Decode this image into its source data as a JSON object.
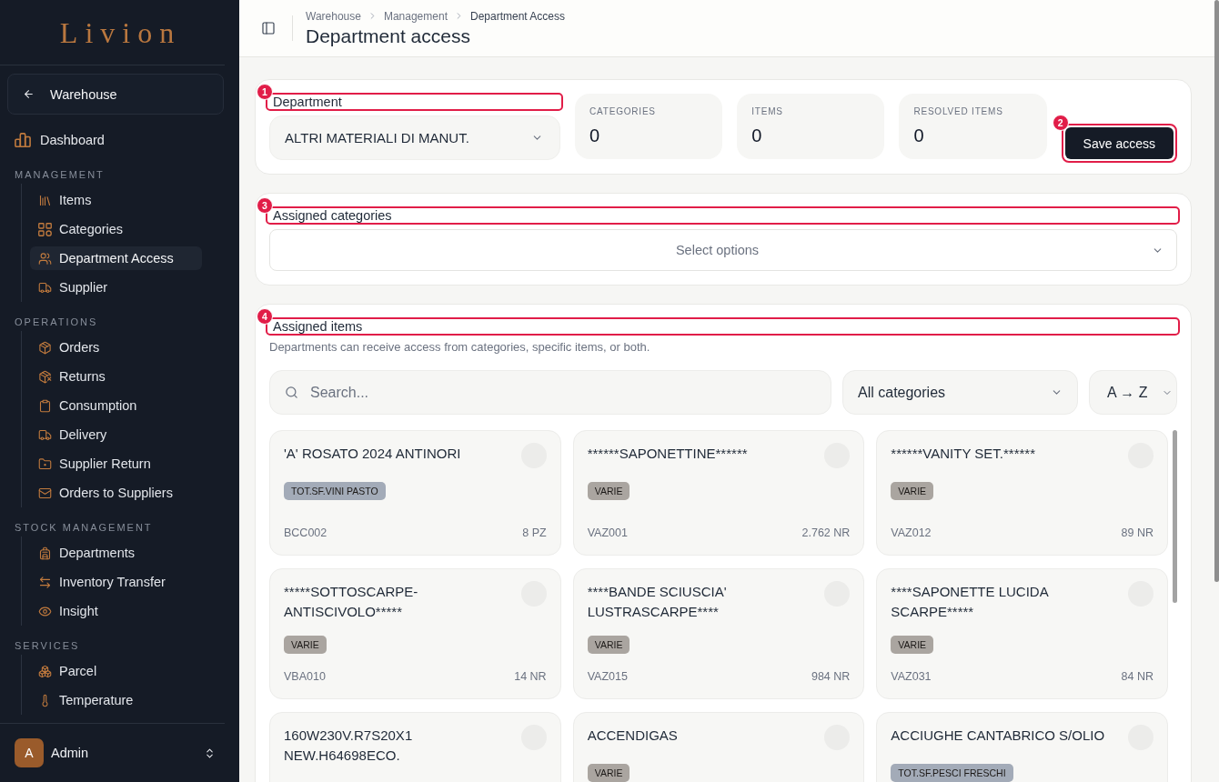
{
  "sidebar": {
    "logo": "Livion",
    "back_button": {
      "label": "Warehouse"
    },
    "top_items": [
      {
        "label": "Dashboard",
        "selected": false
      }
    ],
    "sections": [
      {
        "title": "MANAGEMENT",
        "items": [
          {
            "label": "Items",
            "selected": false
          },
          {
            "label": "Categories",
            "selected": false
          },
          {
            "label": "Department Access",
            "selected": true
          },
          {
            "label": "Supplier",
            "selected": false
          }
        ]
      },
      {
        "title": "OPERATIONS",
        "items": [
          {
            "label": "Orders",
            "selected": false
          },
          {
            "label": "Returns",
            "selected": false
          },
          {
            "label": "Consumption",
            "selected": false
          },
          {
            "label": "Delivery",
            "selected": false
          },
          {
            "label": "Supplier Return",
            "selected": false
          },
          {
            "label": "Orders to Suppliers",
            "selected": false
          }
        ]
      },
      {
        "title": "STOCK MANAGEMENT",
        "items": [
          {
            "label": "Departments",
            "selected": false
          },
          {
            "label": "Inventory Transfer",
            "selected": false
          },
          {
            "label": "Insight",
            "selected": false
          }
        ]
      },
      {
        "title": "SERVICES",
        "items": [
          {
            "label": "Parcel",
            "selected": false
          },
          {
            "label": "Temperature",
            "selected": false
          }
        ]
      }
    ],
    "user": {
      "initial": "A",
      "name": "Admin"
    }
  },
  "header": {
    "breadcrumb": [
      "Warehouse",
      "Management",
      "Department Access"
    ],
    "title": "Department access"
  },
  "department_panel": {
    "department_field": {
      "label": "Department",
      "value": "ALTRI MATERIALI DI MANUT.",
      "callout": "1"
    },
    "stats": [
      {
        "label": "CATEGORIES",
        "value": "0"
      },
      {
        "label": "ITEMS",
        "value": "0"
      },
      {
        "label": "RESOLVED ITEMS",
        "value": "0"
      }
    ],
    "save_button": {
      "label": "Save access",
      "callout": "2"
    }
  },
  "categories_panel": {
    "label": "Assigned categories",
    "callout": "3",
    "placeholder": "Select options"
  },
  "items_panel": {
    "label": "Assigned items",
    "callout": "4",
    "description": "Departments can receive access from categories, specific items, or both.",
    "search": {
      "placeholder": "Search..."
    },
    "category_filter": {
      "value": "All categories"
    },
    "sort": {
      "value": "A → Z"
    },
    "items": [
      {
        "name": "'A' ROSATO 2024 ANTINORI",
        "selected": false,
        "tag": {
          "label": "TOT.SF.VINI PASTO",
          "color": "#a3abb8"
        },
        "code": "BCC002",
        "quantity": "8 PZ"
      },
      {
        "name": "******SAPONETTINE******",
        "selected": false,
        "tag": {
          "label": "VARIE",
          "color": "#aaa5a0"
        },
        "code": "VAZ001",
        "quantity": "2.762 NR"
      },
      {
        "name": "******VANITY SET.******",
        "selected": false,
        "tag": {
          "label": "VARIE",
          "color": "#aaa5a0"
        },
        "code": "VAZ012",
        "quantity": "89 NR"
      },
      {
        "name": "*****SOTTOSCARPE-ANTISCIVOLO*****",
        "selected": false,
        "tag": {
          "label": "VARIE",
          "color": "#aaa5a0"
        },
        "code": "VBA010",
        "quantity": "14 NR"
      },
      {
        "name": "****BANDE SCIUSCIA' LUSTRASCARPE****",
        "selected": false,
        "tag": {
          "label": "VARIE",
          "color": "#aaa5a0"
        },
        "code": "VAZ015",
        "quantity": "984 NR"
      },
      {
        "name": "****SAPONETTE LUCIDA SCARPE*****",
        "selected": false,
        "tag": {
          "label": "VARIE",
          "color": "#aaa5a0"
        },
        "code": "VAZ031",
        "quantity": "84 NR"
      },
      {
        "name": "160W230V.R7S20X1 NEW.H64698ECO.",
        "selected": false
      },
      {
        "name": "ACCENDIGAS",
        "selected": false,
        "tag": {
          "label": "VARIE",
          "color": "#aaa5a0"
        }
      },
      {
        "name": "ACCIUGHE CANTABRICO S/OLIO",
        "selected": false,
        "tag": {
          "label": "TOT.SF.PESCI FRESCHI",
          "color": "#a3abb8"
        }
      }
    ]
  }
}
